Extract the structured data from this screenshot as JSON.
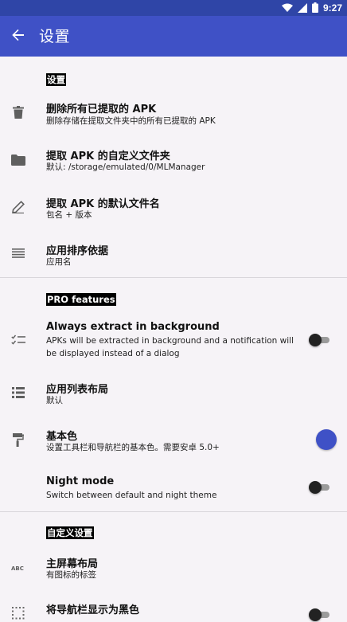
{
  "status_bar": {
    "time": "9:27"
  },
  "app_bar": {
    "title": "设置"
  },
  "sections": [
    {
      "header": "设置",
      "items": [
        {
          "title": "删除所有已提取的 APK",
          "summary": "删除存储在提取文件夹中的所有已提取的 APK",
          "icon": "trash-icon"
        },
        {
          "title": "提取 APK 的自定义文件夹",
          "summary": "默认: /storage/emulated/0/MLManager",
          "icon": "folder-icon"
        },
        {
          "title": "提取 APK 的默认文件名",
          "summary": "包名 + 版本",
          "icon": "pencil-icon"
        },
        {
          "title": "应用排序依据",
          "summary": "应用名",
          "icon": "sort-lines-icon"
        }
      ]
    },
    {
      "header": "PRO features",
      "items": [
        {
          "title": "Always extract in background",
          "summary": "APKs will be extracted in background and a notification will be displayed instead of a dialog",
          "icon": "checklist-icon",
          "toggle": false
        },
        {
          "title": "应用列表布局",
          "summary": "默认",
          "icon": "list-icon"
        },
        {
          "title": "基本色",
          "summary": "设置工具栏和导航栏的基本色。需要安卓 5.0+",
          "icon": "paint-roller-icon",
          "color": "#3f51c6"
        },
        {
          "title": "Night mode",
          "summary": "Switch between default and night theme",
          "icon": "moon-icon",
          "toggle": false
        }
      ]
    },
    {
      "header": "自定义设置",
      "items": [
        {
          "title": "主屏幕布局",
          "summary": "有图标的标签",
          "icon": "text-abc-icon"
        },
        {
          "title": "将导航栏显示为黑色",
          "summary": "",
          "icon": "dotted-grid-icon",
          "toggle": false
        }
      ]
    }
  ],
  "colors": {
    "status_bar": "#2f45a7",
    "app_bar": "#3f51c6",
    "accent": "#3f51c6",
    "background": "#f6f3f7"
  }
}
